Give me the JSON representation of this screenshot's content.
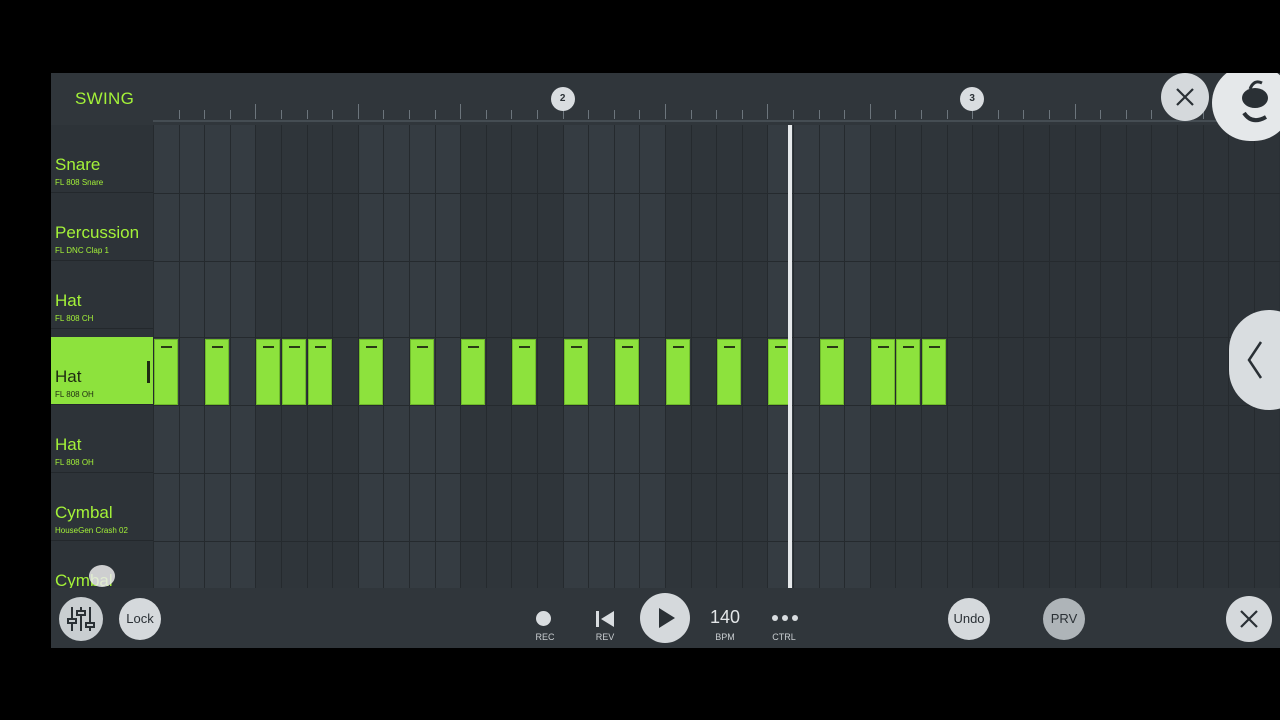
{
  "header": {
    "swing_label": "SWING",
    "bar_markers": [
      {
        "label": "2",
        "step": 16
      },
      {
        "label": "3",
        "step": 32
      }
    ]
  },
  "channels": [
    {
      "name": "Snare",
      "sample": "FL 808 Snare",
      "selected": false
    },
    {
      "name": "Percussion",
      "sample": "FL DNC Clap 1",
      "selected": false
    },
    {
      "name": "Hat",
      "sample": "FL 808 CH",
      "selected": false
    },
    {
      "name": "Hat",
      "sample": "FL 808 OH",
      "selected": true
    },
    {
      "name": "Hat",
      "sample": "FL 808 OH",
      "selected": false
    },
    {
      "name": "Cymbal",
      "sample": "HouseGen Crash 02",
      "selected": false
    },
    {
      "name": "Cymbal",
      "sample": "",
      "selected": false
    }
  ],
  "pattern": {
    "total_steps": 32,
    "active_row": 3,
    "active_steps": [
      0,
      2,
      4,
      5,
      6,
      8,
      10,
      12,
      14,
      16,
      18,
      20,
      22,
      24,
      26,
      28,
      29,
      30
    ],
    "playhead_step": 24.8
  },
  "toolbar": {
    "lock_label": "Lock",
    "rec_label": "REC",
    "rev_label": "REV",
    "bpm_value": "140",
    "bpm_label": "BPM",
    "ctrl_label": "CTRL",
    "undo_label": "Undo",
    "prv_label": "PRV"
  },
  "icons": {
    "mixer": "mixer-icon",
    "record": "record-dot-icon",
    "rewind": "skip-back-icon",
    "play": "play-icon",
    "more": "more-dots-icon",
    "close": "close-icon",
    "logo": "fl-fruit-logo-icon",
    "collapse": "chevron-left-icon"
  },
  "colors": {
    "accent": "#a4f238",
    "step_on": "#8de23d",
    "background": "#2a3035",
    "button": "#d5d9dc"
  }
}
